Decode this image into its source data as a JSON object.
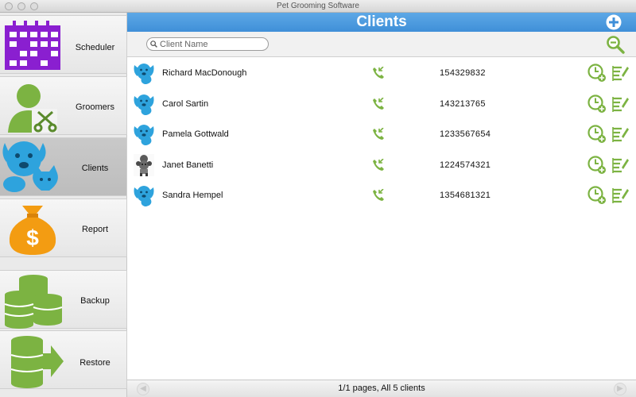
{
  "window": {
    "title": "Pet Grooming Software"
  },
  "sidebar": {
    "items": [
      {
        "label": "Scheduler",
        "icon": "calendar-icon"
      },
      {
        "label": "Groomers",
        "icon": "groomer-scissors-icon"
      },
      {
        "label": "Clients",
        "icon": "dog-cat-icon",
        "active": true
      },
      {
        "label": "Report",
        "icon": "money-bag-icon"
      },
      {
        "label": "Backup",
        "icon": "database-icon"
      },
      {
        "label": "Restore",
        "icon": "database-restore-icon"
      }
    ]
  },
  "header": {
    "title": "Clients",
    "add_icon": "plus-circle-icon"
  },
  "search": {
    "placeholder": "Client Name",
    "value": "",
    "button_icon": "magnifier-icon"
  },
  "clients": [
    {
      "name": "Richard MacDonough",
      "phone": "154329832",
      "avatar": "blue-dog-avatar"
    },
    {
      "name": "Carol Sartin",
      "phone": "143213765",
      "avatar": "blue-dog-avatar"
    },
    {
      "name": "Pamela Gottwald",
      "phone": "1233567654",
      "avatar": "blue-dog-avatar"
    },
    {
      "name": "Janet Banetti",
      "phone": "1224574321",
      "avatar": "poodle-photo-avatar"
    },
    {
      "name": "Sandra Hempel",
      "phone": "1354681321",
      "avatar": "blue-dog-avatar"
    }
  ],
  "footer": {
    "pages_text": "1/1 pages, All 5 clients"
  },
  "colors": {
    "header_blue": "#4a9ae0",
    "accent_green": "#7cb342",
    "icon_blue": "#2ea3dd",
    "purple": "#8a1fd0",
    "orange": "#f39c12"
  }
}
